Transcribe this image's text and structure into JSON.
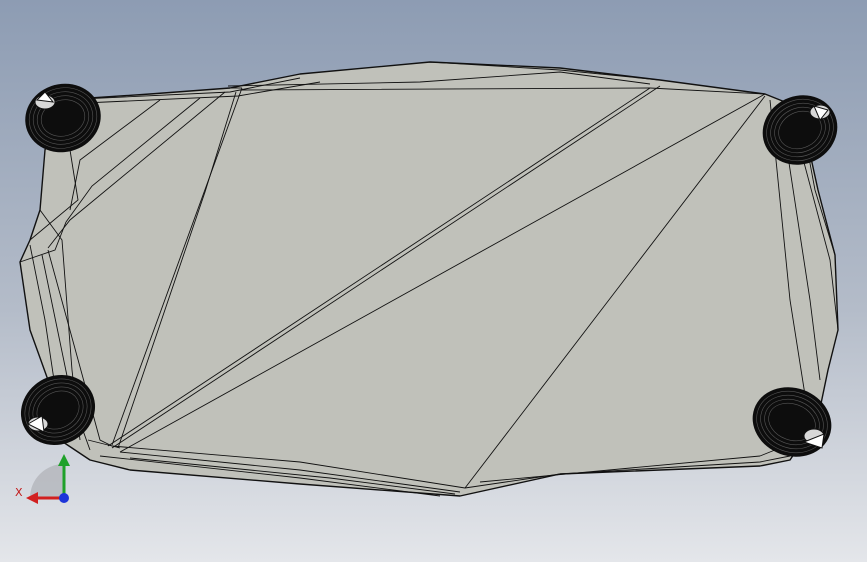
{
  "viewport": {
    "background_top": "#8d9cb3",
    "background_bottom": "#e4e6ea",
    "model_fill": "#c0c1ba",
    "edge_color": "#111111",
    "knob_color": "#0d0d0d"
  },
  "triad": {
    "x_label": "X",
    "x_color": "#d11f1f",
    "y_color": "#1fa12a",
    "z_color": "#1d34d9"
  },
  "knob_icon": "threaded-knob-icon"
}
